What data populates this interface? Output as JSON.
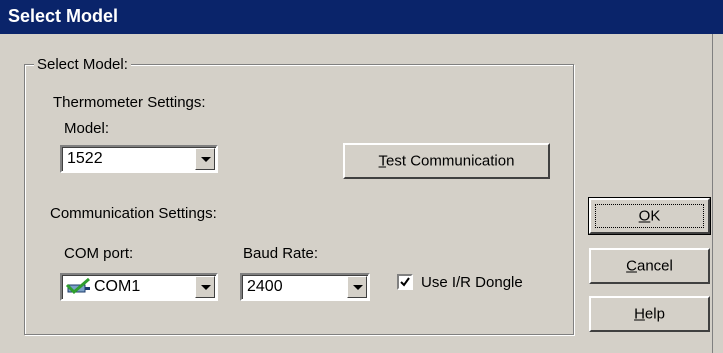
{
  "window": {
    "title": "Select Model"
  },
  "group": {
    "legend": "Select Model:"
  },
  "thermometer": {
    "section_label": "Thermometer Settings:",
    "model_label": "Model:",
    "model_value": "1522",
    "test_button_pre": "",
    "test_button_mnemonic": "T",
    "test_button_post": "est Communication"
  },
  "communication": {
    "section_label": "Communication Settings:",
    "com_port_label": "COM port:",
    "com_port_value": "COM1",
    "baud_rate_label": "Baud Rate:",
    "baud_rate_value": "2400",
    "dongle_label": "Use I/R Dongle",
    "dongle_checked": true
  },
  "buttons": {
    "ok_mnemonic": "O",
    "ok_post": "K",
    "cancel_mnemonic": "C",
    "cancel_post": "ancel",
    "help_mnemonic": "H",
    "help_post": "elp"
  },
  "icons": {
    "com_port_icon": "port-connected-icon",
    "checkmark": "check-icon",
    "dropdown": "chevron-down-icon"
  },
  "colors": {
    "title_bar": "#0a246a",
    "face": "#d4d0c8",
    "check_green": "#2e9e2e"
  }
}
